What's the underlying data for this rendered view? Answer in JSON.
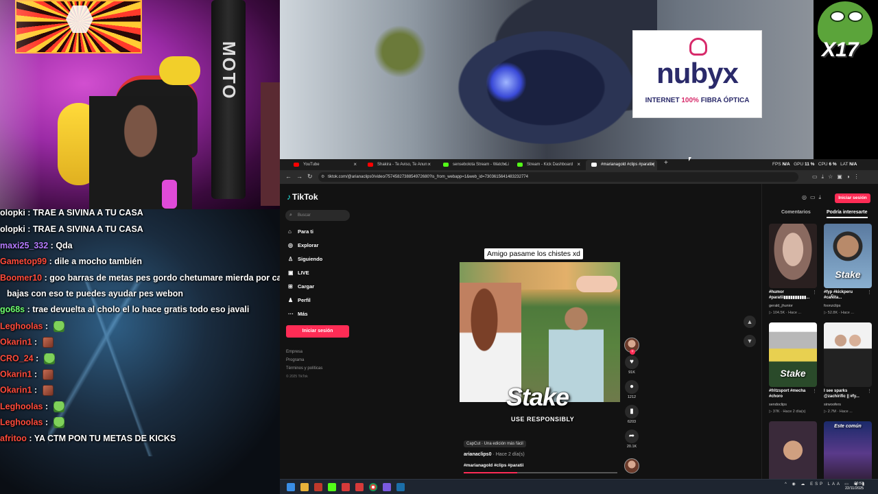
{
  "webcam": {
    "bag_text": "MOTO"
  },
  "chat": {
    "messages": [
      {
        "user": "olopki",
        "text": "TRAE A SIVINA A TU CASA",
        "color": "#ffffff",
        "emote": ""
      },
      {
        "user": "olopki",
        "text": "TRAE A SIVINA A TU CASA",
        "color": "#ffffff",
        "emote": ""
      },
      {
        "user": "maxi25_332",
        "text": "Qda",
        "color": "#b57bff",
        "emote": ""
      },
      {
        "user": "Gametop99",
        "text": "dile a mocho también",
        "color": "#ff4a3a",
        "emote": ""
      },
      {
        "user": "Boomer10",
        "text": "goo barras de metas pes gordo chetumare mierda por cada",
        "color": "#ff4a3a",
        "emote": ""
      },
      {
        "user": "",
        "text": "bajas con eso te puedes ayudar pes webon",
        "color": "#ffffff",
        "emote": ""
      },
      {
        "user": "go68s",
        "text": "trae devuelta al cholo el lo hace gratis todo eso javali",
        "color": "#6dff6d",
        "emote": ""
      },
      {
        "user": "Leghoolas",
        "text": "",
        "color": "#ff4a3a",
        "emote": "frog"
      },
      {
        "user": "Okarin1",
        "text": "",
        "color": "#ff4a3a",
        "emote": "box"
      },
      {
        "user": "CRO_24",
        "text": "",
        "color": "#ff4a3a",
        "emote": "frog"
      },
      {
        "user": "Okarin1",
        "text": "",
        "color": "#ff4a3a",
        "emote": "box"
      },
      {
        "user": "Okarin1",
        "text": "",
        "color": "#ff4a3a",
        "emote": "box"
      },
      {
        "user": "Leghoolas",
        "text": "",
        "color": "#ff4a3a",
        "emote": "frog"
      },
      {
        "user": "Leghoolas",
        "text": "",
        "color": "#ff4a3a",
        "emote": "frog"
      },
      {
        "user": "afritoo",
        "text": "YA CTM PON TU METAS DE KICKS",
        "color": "#ff4a3a",
        "emote": ""
      }
    ]
  },
  "ad": {
    "brand": "nubyx",
    "tag_prefix": "INTERNET ",
    "tag_highlight": "100%",
    "tag_suffix": " FIBRA ÓPTICA"
  },
  "pepe": {
    "count": "X17"
  },
  "browser": {
    "tabs": [
      {
        "label": "YouTube",
        "color": "#ff0000"
      },
      {
        "label": "Shakira - Te Aviso, Te Anun",
        "color": "#ff0000"
      },
      {
        "label": "sensebolota Stream - Watch Li",
        "color": "#53fc18"
      },
      {
        "label": "Stream - Kick Dashboard",
        "color": "#53fc18"
      },
      {
        "label": "#marianagold #clips #paratii |",
        "color": "#ffffff"
      }
    ],
    "new_tab": "+",
    "perf": {
      "fps_label": "FPS",
      "fps": "N/A",
      "gpu_label": "GPU",
      "gpu": "11 %",
      "cpu_label": "CPU",
      "cpu": "6 %",
      "lat_label": "LAT",
      "lat": "N/A"
    },
    "url": "tiktok.com/@arianaclips0/video/7574582738854972680?is_from_webapp=1&web_id=7303615641483232774"
  },
  "tiktok": {
    "logo": "TikTok",
    "search_placeholder": "Buscar",
    "nav": [
      {
        "label": "Para ti",
        "icon": "⌂"
      },
      {
        "label": "Explorar",
        "icon": "◎"
      },
      {
        "label": "Siguiendo",
        "icon": "♙"
      },
      {
        "label": "LIVE",
        "icon": "▣"
      },
      {
        "label": "Cargar",
        "icon": "⊞"
      },
      {
        "label": "Perfil",
        "icon": "♟"
      },
      {
        "label": "Más",
        "icon": "···"
      }
    ],
    "login": "Iniciar sesión",
    "footer": [
      "Empresa",
      "Programa",
      "Términos y políticas"
    ],
    "copyright": "© 2025 TikTok",
    "video": {
      "caption": "Amigo pasame los chistes xd",
      "overlay": "Stake",
      "overlay_sub": "USE RESPONSIBLY",
      "capcut": "CapCut · Una edición más fácil",
      "author": "arianaclips0",
      "date": " · Hace 2 día(s)",
      "tags": "#marianagold #clips #paratii",
      "progress": 0.35
    },
    "actions": [
      {
        "icon": "♥",
        "count": "91K"
      },
      {
        "icon": "●",
        "count": "1212"
      },
      {
        "icon": "▮",
        "count": "6203"
      },
      {
        "icon": "➦",
        "count": "20.1K"
      }
    ],
    "right": {
      "login": "Iniciar sesión",
      "tabs": [
        "Comentarios",
        "Podría interesarte"
      ],
      "cards": [
        {
          "title": "#humor #paratii▮▮▮▮▮▮▮▮▮▮...",
          "author": "gerald_jhunior",
          "meta": "▷ 104.5K · Hace ..."
        },
        {
          "title": "#fyp #kickperu #caÑita...",
          "author": "foonzclips",
          "meta": "▷ 52.8K · Hace ..."
        },
        {
          "title": "#fritzsport #mecha #choro",
          "author": "sendoclips",
          "meta": "▷ 37K · Hace 2 día(s)"
        },
        {
          "title": "I see sparks @zachirific || #fy...",
          "author": "sirwoofers",
          "meta": "▷ 2.7M · Hace ..."
        },
        {
          "title": "",
          "author": "",
          "meta": ""
        },
        {
          "title": "",
          "author": "",
          "meta": ""
        }
      ],
      "thumb_texts": [
        "",
        "Stake",
        "Stake",
        "",
        "",
        "Este común"
      ]
    }
  },
  "taskbar": {
    "lang": "ESP LAA",
    "time": "00:53",
    "date": "22/11/2025"
  }
}
